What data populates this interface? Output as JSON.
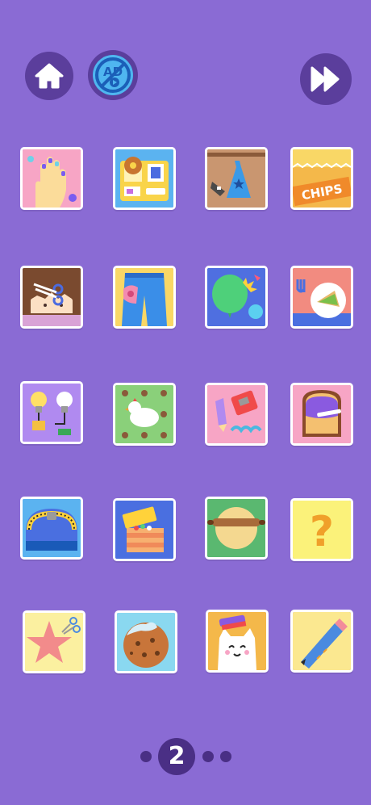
{
  "top_bar": {
    "home_icon": "home-icon",
    "no_ads_icon": "no-ads-icon",
    "no_ads_text": "AD",
    "skip_icon": "fast-forward-icon"
  },
  "games": [
    {
      "name": "nail-painting",
      "icon": "painted-hand-icon"
    },
    {
      "name": "lunch-box",
      "icon": "lunch-tray-icon"
    },
    {
      "name": "dress-hanger",
      "icon": "blue-dress-icon"
    },
    {
      "name": "chips-bag",
      "icon": "chips-icon",
      "text": "CHIPS"
    },
    {
      "name": "hair-cut",
      "icon": "scissors-hair-icon"
    },
    {
      "name": "jeans-patch",
      "icon": "jeans-icon"
    },
    {
      "name": "balloon-pop",
      "icon": "balloon-icon"
    },
    {
      "name": "sandwich-plate",
      "icon": "sandwich-icon"
    },
    {
      "name": "light-bulbs",
      "icon": "light-bulb-icon"
    },
    {
      "name": "chicken",
      "icon": "chicken-icon"
    },
    {
      "name": "pencil-sharpener",
      "icon": "sharpener-icon"
    },
    {
      "name": "jam-toast",
      "icon": "toast-icon"
    },
    {
      "name": "zipper-bag",
      "icon": "zipper-icon"
    },
    {
      "name": "treasure-box",
      "icon": "box-icon"
    },
    {
      "name": "dough-roll",
      "icon": "rolling-pin-icon"
    },
    {
      "name": "mystery",
      "icon": "question-icon",
      "text": "?"
    },
    {
      "name": "star-cutout",
      "icon": "star-scissors-icon"
    },
    {
      "name": "cookie",
      "icon": "cookie-icon"
    },
    {
      "name": "cat-grooming",
      "icon": "cat-brush-icon"
    },
    {
      "name": "pen-drawing",
      "icon": "pen-icon"
    }
  ],
  "pager": {
    "current": "2"
  },
  "colors": {
    "background": "#8a6bd4",
    "button": "#5b3e9c",
    "no_ads": "#4fb6f0"
  }
}
